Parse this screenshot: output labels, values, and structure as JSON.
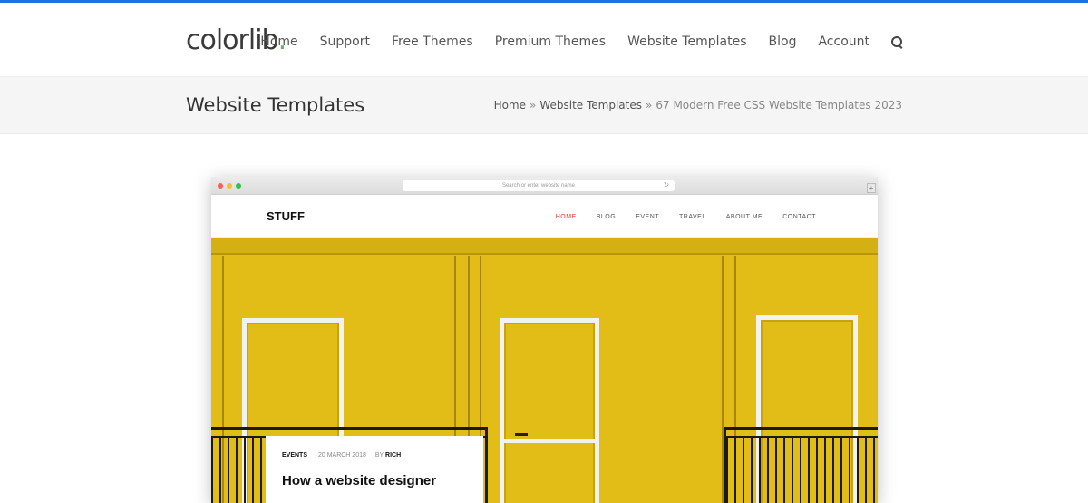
{
  "brand": {
    "logo": "colorlib",
    "logo_dot": ".",
    "accent": "#1a73e8",
    "dot_color": "#5cb85c"
  },
  "nav": {
    "items": [
      "Home",
      "Support",
      "Free Themes",
      "Premium Themes",
      "Website Templates",
      "Blog",
      "Account"
    ],
    "search_icon": "search-icon"
  },
  "title_bar": {
    "title": "Website Templates",
    "breadcrumb": {
      "home": "Home",
      "sep": "»",
      "section": "Website Templates",
      "current": "67 Modern Free CSS Website Templates 2023"
    }
  },
  "preview": {
    "browser": {
      "url_placeholder": "Search or enter website name",
      "reload_icon": "↻",
      "new_tab_icon": "+"
    },
    "site": {
      "logo": "STUFF",
      "menu": [
        "HOME",
        "BLOG",
        "EVENT",
        "TRAVEL",
        "ABOUT ME",
        "CONTACT"
      ],
      "active_menu": "HOME",
      "hero_color": "#e2bd17",
      "post": {
        "category": "EVENTS",
        "date": "20 MARCH 2018",
        "by": "BY",
        "author": "RICH",
        "title": "How a website designer"
      }
    }
  }
}
